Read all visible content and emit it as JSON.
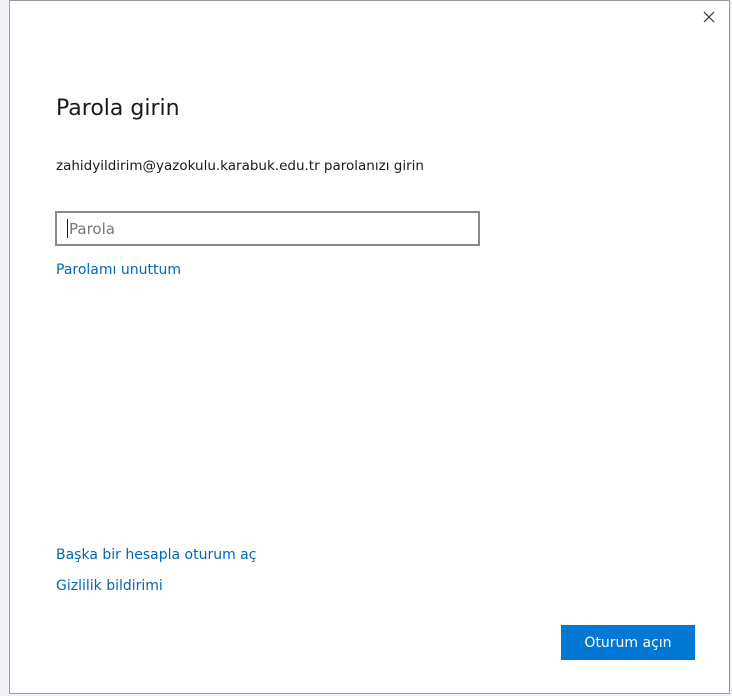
{
  "dialog": {
    "close_icon": "close-icon",
    "title": "Parola girin",
    "subtitle": "zahidyildirim@yazokulu.karabuk.edu.tr parolanızı girin",
    "password": {
      "value": "",
      "placeholder": "Parola"
    },
    "forgot_password_link": "Parolamı unuttum",
    "other_account_link": "Başka bir hesapla oturum aç",
    "privacy_link": "Gizlilik bildirimi",
    "signin_button": "Oturum açın"
  },
  "colors": {
    "link": "#0067b8",
    "primary_button": "#0078d4",
    "text": "#1a1a1a",
    "input_border": "#8a8a8a"
  }
}
